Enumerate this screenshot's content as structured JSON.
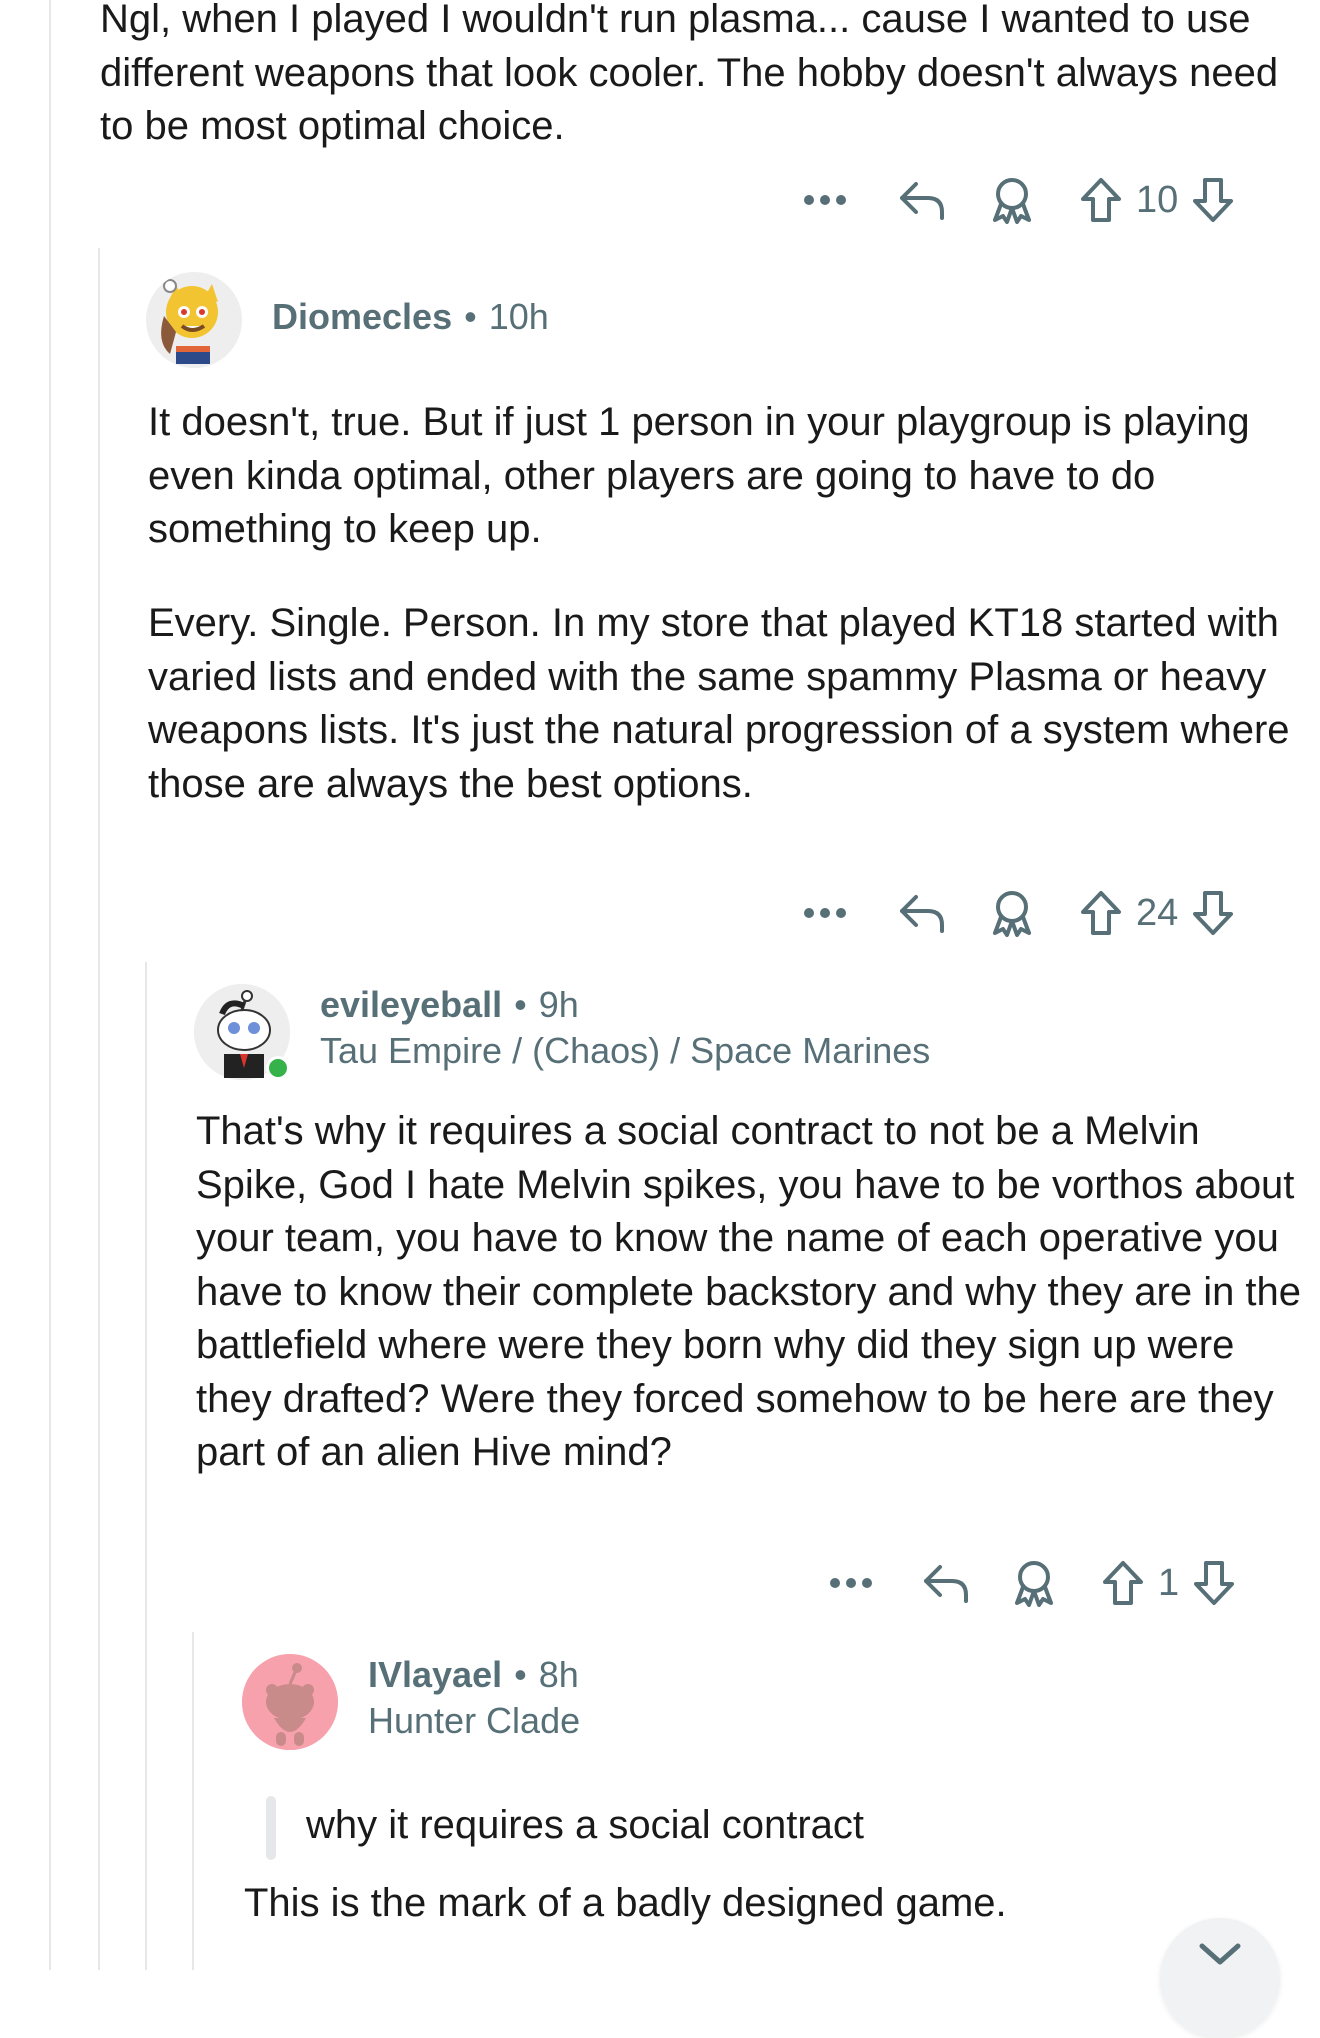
{
  "comment0": {
    "body": "Ngl, when I played I wouldn't run plasma... cause I wanted to use different weapons that look cooler. The hobby doesn't always need to be most optimal choice.",
    "votes": "10"
  },
  "comment1": {
    "username": "Diomecles",
    "time": "10h",
    "paragraphs": [
      "It doesn't, true. But if just 1 person in your playgroup is playing even kinda optimal, other players are going to have to do something to keep up.",
      "Every. Single. Person. In my store that played KT18 started with varied lists and ended with the same spammy Plasma or heavy weapons lists. It's just the natural progression of a system where those are always the best options."
    ],
    "votes": "24"
  },
  "comment2": {
    "username": "evileyeball",
    "time": "9h",
    "flair": "Tau Empire / (Chaos) / Space Marines",
    "body": "That's why it requires a social contract to not be a Melvin Spike, God I hate Melvin spikes, you have to be vorthos about your team, you have to know the name of each operative you have to know their complete backstory and why they are in the battlefield where were they born why did they sign up were they drafted? Were they forced somehow to be here are they part of an alien Hive mind?",
    "votes": "1"
  },
  "comment3": {
    "username": "IVlayael",
    "time": "8h",
    "flair": "Hunter Clade",
    "quote": "why it requires a social contract",
    "body": "This is the mark of a badly designed game."
  },
  "separator": "•",
  "icons": {
    "more": "more-options-icon",
    "reply": "reply-icon",
    "award": "award-icon",
    "upvote": "upvote-icon",
    "downvote": "downvote-icon"
  },
  "colors": {
    "meta_text": "#576f76",
    "body_text": "#1a1a1b",
    "thread_line": "#e5e7ea",
    "online": "#36b24a",
    "avatar_pink": "#f7a1ad"
  }
}
